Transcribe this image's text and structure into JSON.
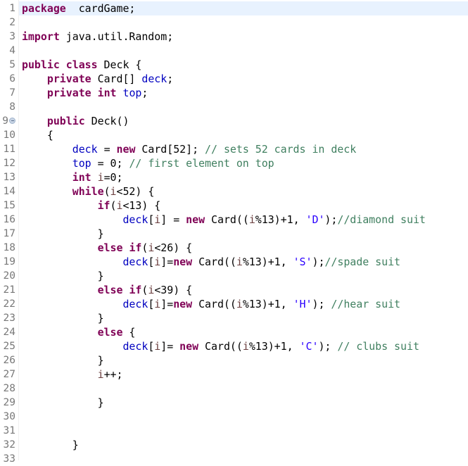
{
  "editor": {
    "language": "java",
    "current_line": 1,
    "colors": {
      "keyword": "#7f0055",
      "field": "#0000c0",
      "local_variable": "#6a3e3e",
      "comment": "#3f7f5f",
      "string": "#2a00ff",
      "current_line_bg": "#e8f2fe",
      "line_number": "#787878"
    },
    "lines": [
      {
        "n": "1",
        "tokens": [
          [
            "kw",
            "package"
          ],
          [
            "",
            "  cardGame;"
          ]
        ]
      },
      {
        "n": "2",
        "tokens": []
      },
      {
        "n": "3",
        "tokens": [
          [
            "kw",
            "import"
          ],
          [
            "",
            " java.util.Random;"
          ]
        ]
      },
      {
        "n": "4",
        "tokens": []
      },
      {
        "n": "5",
        "tokens": [
          [
            "kw",
            "public"
          ],
          [
            "",
            " "
          ],
          [
            "kw",
            "class"
          ],
          [
            "",
            " Deck {"
          ]
        ]
      },
      {
        "n": "6",
        "tokens": [
          [
            "",
            "    "
          ],
          [
            "kw",
            "private"
          ],
          [
            "",
            " Card[] "
          ],
          [
            "field",
            "deck"
          ],
          [
            "",
            ";"
          ]
        ]
      },
      {
        "n": "7",
        "tokens": [
          [
            "",
            "    "
          ],
          [
            "kw",
            "private"
          ],
          [
            "",
            " "
          ],
          [
            "kw",
            "int"
          ],
          [
            "",
            " "
          ],
          [
            "field",
            "top"
          ],
          [
            "",
            ";"
          ]
        ]
      },
      {
        "n": "8",
        "tokens": []
      },
      {
        "n": "9",
        "fold": true,
        "tokens": [
          [
            "",
            "    "
          ],
          [
            "kw",
            "public"
          ],
          [
            "",
            " Deck()"
          ]
        ]
      },
      {
        "n": "10",
        "tokens": [
          [
            "",
            "    {"
          ]
        ]
      },
      {
        "n": "11",
        "tokens": [
          [
            "",
            "        "
          ],
          [
            "field",
            "deck"
          ],
          [
            "",
            " = "
          ],
          [
            "kw",
            "new"
          ],
          [
            "",
            " Card[52]; "
          ],
          [
            "cmt",
            "// sets 52 cards in deck"
          ]
        ]
      },
      {
        "n": "12",
        "tokens": [
          [
            "",
            "        "
          ],
          [
            "field",
            "top"
          ],
          [
            "",
            " = 0; "
          ],
          [
            "cmt",
            "// first element on top"
          ]
        ]
      },
      {
        "n": "13",
        "tokens": [
          [
            "",
            "        "
          ],
          [
            "kw",
            "int"
          ],
          [
            "",
            " "
          ],
          [
            "local",
            "i"
          ],
          [
            "",
            "=0;"
          ]
        ]
      },
      {
        "n": "14",
        "tokens": [
          [
            "",
            "        "
          ],
          [
            "kw",
            "while"
          ],
          [
            "",
            "("
          ],
          [
            "local",
            "i"
          ],
          [
            "",
            "<52) {"
          ]
        ]
      },
      {
        "n": "15",
        "tokens": [
          [
            "",
            "            "
          ],
          [
            "kw",
            "if"
          ],
          [
            "",
            "("
          ],
          [
            "local",
            "i"
          ],
          [
            "",
            "<13) {"
          ]
        ]
      },
      {
        "n": "16",
        "tokens": [
          [
            "",
            "                "
          ],
          [
            "field",
            "deck"
          ],
          [
            "",
            "["
          ],
          [
            "local",
            "i"
          ],
          [
            "",
            "] = "
          ],
          [
            "kw",
            "new"
          ],
          [
            "",
            " Card(("
          ],
          [
            "local",
            "i"
          ],
          [
            "",
            "%13)+1, "
          ],
          [
            "str",
            "'D'"
          ],
          [
            "",
            ");"
          ],
          [
            "cmt",
            "//diamond suit"
          ]
        ]
      },
      {
        "n": "17",
        "tokens": [
          [
            "",
            "            }"
          ]
        ]
      },
      {
        "n": "18",
        "tokens": [
          [
            "",
            "            "
          ],
          [
            "kw",
            "else"
          ],
          [
            "",
            " "
          ],
          [
            "kw",
            "if"
          ],
          [
            "",
            "("
          ],
          [
            "local",
            "i"
          ],
          [
            "",
            "<26) {"
          ]
        ]
      },
      {
        "n": "19",
        "tokens": [
          [
            "",
            "                "
          ],
          [
            "field",
            "deck"
          ],
          [
            "",
            "["
          ],
          [
            "local",
            "i"
          ],
          [
            "",
            "]="
          ],
          [
            "kw",
            "new"
          ],
          [
            "",
            " Card(("
          ],
          [
            "local",
            "i"
          ],
          [
            "",
            "%13)+1, "
          ],
          [
            "str",
            "'S'"
          ],
          [
            "",
            ");"
          ],
          [
            "cmt",
            "//spade suit"
          ]
        ]
      },
      {
        "n": "20",
        "tokens": [
          [
            "",
            "            }"
          ]
        ]
      },
      {
        "n": "21",
        "tokens": [
          [
            "",
            "            "
          ],
          [
            "kw",
            "else"
          ],
          [
            "",
            " "
          ],
          [
            "kw",
            "if"
          ],
          [
            "",
            "("
          ],
          [
            "local",
            "i"
          ],
          [
            "",
            "<39) {"
          ]
        ]
      },
      {
        "n": "22",
        "tokens": [
          [
            "",
            "                "
          ],
          [
            "field",
            "deck"
          ],
          [
            "",
            "["
          ],
          [
            "local",
            "i"
          ],
          [
            "",
            "]="
          ],
          [
            "kw",
            "new"
          ],
          [
            "",
            " Card(("
          ],
          [
            "local",
            "i"
          ],
          [
            "",
            "%13)+1, "
          ],
          [
            "str",
            "'H'"
          ],
          [
            "",
            "); "
          ],
          [
            "cmt",
            "//hear suit"
          ]
        ]
      },
      {
        "n": "23",
        "tokens": [
          [
            "",
            "            }"
          ]
        ]
      },
      {
        "n": "24",
        "tokens": [
          [
            "",
            "            "
          ],
          [
            "kw",
            "else"
          ],
          [
            "",
            " {"
          ]
        ]
      },
      {
        "n": "25",
        "tokens": [
          [
            "",
            "                "
          ],
          [
            "field",
            "deck"
          ],
          [
            "",
            "["
          ],
          [
            "local",
            "i"
          ],
          [
            "",
            "]= "
          ],
          [
            "kw",
            "new"
          ],
          [
            "",
            " Card(("
          ],
          [
            "local",
            "i"
          ],
          [
            "",
            "%13)+1, "
          ],
          [
            "str",
            "'C'"
          ],
          [
            "",
            "); "
          ],
          [
            "cmt",
            "// clubs suit"
          ]
        ]
      },
      {
        "n": "26",
        "tokens": [
          [
            "",
            "            }"
          ]
        ]
      },
      {
        "n": "27",
        "tokens": [
          [
            "",
            "            "
          ],
          [
            "local",
            "i"
          ],
          [
            "",
            "++;"
          ]
        ]
      },
      {
        "n": "28",
        "tokens": []
      },
      {
        "n": "29",
        "tokens": [
          [
            "",
            "            }"
          ]
        ]
      },
      {
        "n": "30",
        "tokens": []
      },
      {
        "n": "31",
        "tokens": []
      },
      {
        "n": "32",
        "tokens": [
          [
            "",
            "        }"
          ]
        ]
      },
      {
        "n": "33",
        "tokens": []
      }
    ]
  }
}
